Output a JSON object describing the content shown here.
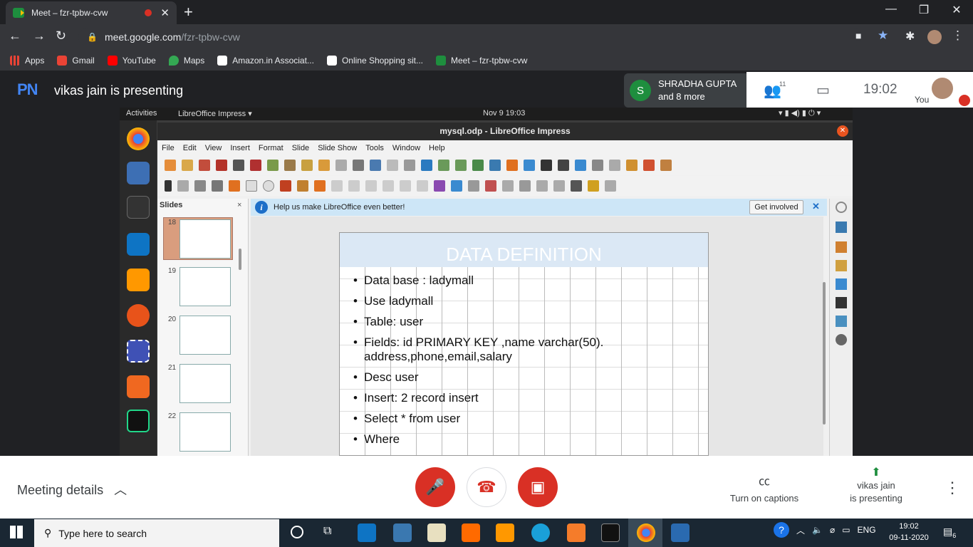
{
  "browser": {
    "tab_title": "Meet – fzr-tpbw-cvw",
    "url_domain": "meet.google.com",
    "url_path": "/fzr-tpbw-cvw",
    "bookmarks": [
      "Apps",
      "Gmail",
      "YouTube",
      "Maps",
      "Amazon.in Associat...",
      "Online Shopping sit...",
      "Meet – fzr-tpbw-cvw"
    ]
  },
  "meet": {
    "logo_text": "PN",
    "presenting_title": "vikas jain is presenting",
    "participant_initial": "S",
    "participant_name": "SHRADHA GUPTA",
    "participant_more": "and 8 more",
    "participant_count": "11",
    "time": "19:02",
    "self_label": "You",
    "meeting_details": "Meeting details",
    "captions_label": "Turn on captions",
    "presenter_line1": "vikas jain",
    "presenter_line2": "is presenting"
  },
  "ubuntu": {
    "activities": "Activities",
    "app_menu": "LibreOffice Impress ▾",
    "datetime": "Nov 9  19:03"
  },
  "libreoffice": {
    "window_title": "mysql.odp - LibreOffice Impress",
    "menu": [
      "File",
      "Edit",
      "View",
      "Insert",
      "Format",
      "Slide",
      "Slide Show",
      "Tools",
      "Window",
      "Help"
    ],
    "slides_header": "Slides",
    "slide_numbers": [
      "18",
      "19",
      "20",
      "21",
      "22"
    ],
    "infobar_text": "Help us make LibreOffice even better!",
    "get_involved": "Get involved",
    "slide": {
      "heading": "DATA DEFINITION",
      "bullets": [
        "Data base : ladymall",
        "Use ladymall",
        "Table: user",
        "Fields: id PRIMARY KEY ,name varchar(50). address,phone,email,salary",
        "Desc user",
        "Insert: 2 record insert",
        "Select * from user",
        "Where"
      ]
    }
  },
  "taskbar": {
    "search_placeholder": "Type here to search",
    "lang": "ENG",
    "time": "19:02",
    "date": "09-11-2020",
    "notifications": "6"
  },
  "colors": {
    "meet_red": "#d93025",
    "meet_bg": "#202124",
    "slide_header": "#dbe8f5"
  }
}
